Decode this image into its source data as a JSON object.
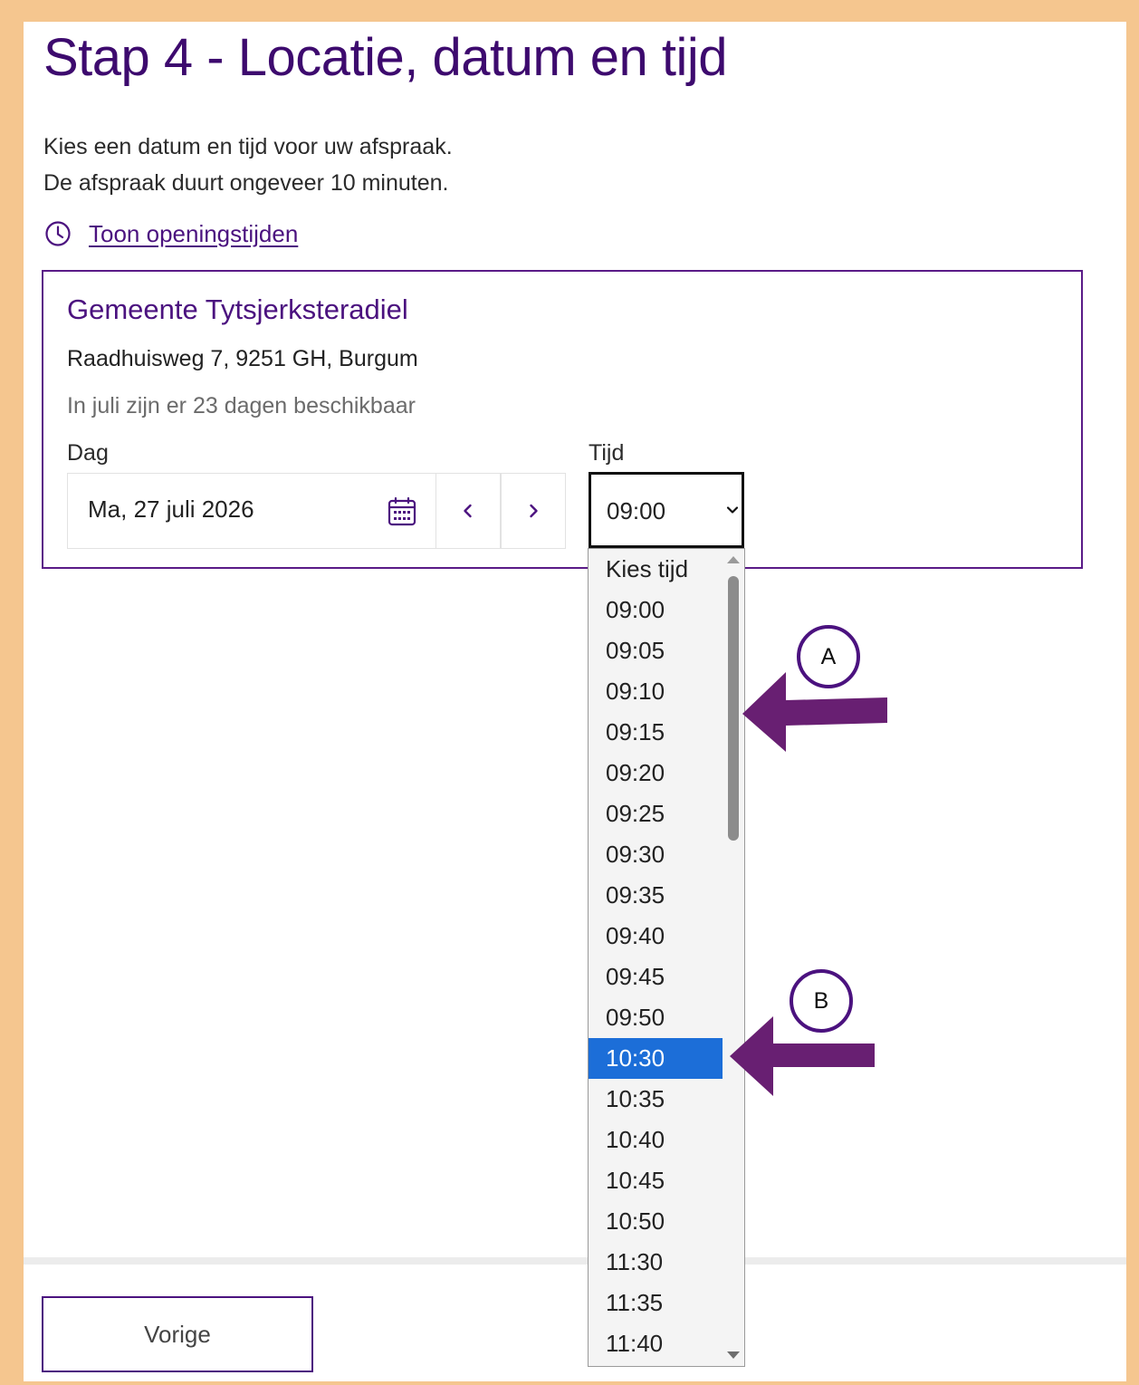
{
  "page": {
    "title": "Stap 4 - Locatie, datum en tijd",
    "intro_line1": "Kies een datum en tijd voor uw afspraak.",
    "intro_line2": "De afspraak duurt ongeveer 10 minuten.",
    "opening_hours_link": "Toon openingstijden"
  },
  "location": {
    "name": "Gemeente Tytsjerksteradiel",
    "address": "Raadhuisweg 7, 9251 GH, Burgum",
    "availability": "In juli zijn er 23 dagen beschikbaar"
  },
  "date_picker": {
    "label": "Dag",
    "value": "Ma, 27 juli 2026"
  },
  "time_picker": {
    "label": "Tijd",
    "value": "09:00",
    "options": [
      "Kies tijd",
      "09:00",
      "09:05",
      "09:10",
      "09:15",
      "09:20",
      "09:25",
      "09:30",
      "09:35",
      "09:40",
      "09:45",
      "09:50",
      "10:30",
      "10:35",
      "10:40",
      "10:45",
      "10:50",
      "11:30",
      "11:35",
      "11:40"
    ],
    "highlighted_option": "10:30"
  },
  "annotations": [
    {
      "label": "A"
    },
    {
      "label": "B"
    }
  ],
  "footer": {
    "prev_label": "Vorige"
  },
  "colors": {
    "frame": "#f5c68f",
    "brand_purple": "#4b127f",
    "highlight_blue": "#1c6ed8",
    "arrow_purple": "#681f72"
  },
  "icons": {
    "opening_hours": "clock-icon",
    "date": "calendar-icon",
    "prev_day": "chevron-left-icon",
    "next_day": "chevron-right-icon",
    "select": "chevron-down-icon"
  }
}
